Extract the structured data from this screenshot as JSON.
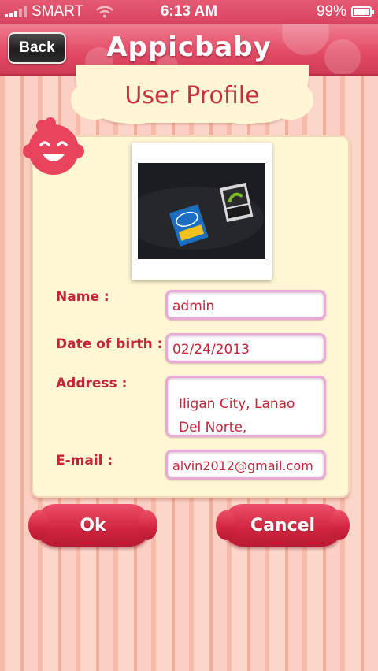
{
  "status_bar": {
    "carrier": "SMART",
    "time": "6:13 AM",
    "battery": "99%"
  },
  "navbar": {
    "back_label": "Back",
    "title": "Appicbaby"
  },
  "page": {
    "title": "User Profile"
  },
  "form": {
    "name_label": "Name :",
    "name_value": "admin",
    "dob_label": "Date of birth :",
    "dob_value": "02/24/2013",
    "address_label": "Address :",
    "address_line1": "Iligan City, Lanao",
    "address_line2": "Del Norte,",
    "email_label": "E-mail :",
    "email_value": "alvin2012@gmail.com"
  },
  "actions": {
    "ok_label": "Ok",
    "cancel_label": "Cancel"
  },
  "colors": {
    "accent": "#d9425f",
    "label": "#c32437",
    "card": "#fff6d4"
  }
}
